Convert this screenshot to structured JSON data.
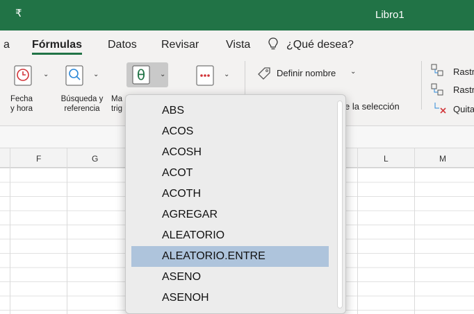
{
  "titlebar": {
    "quick_access": "₹",
    "document_title": "Libro1"
  },
  "tabs": [
    {
      "label": "a"
    },
    {
      "label": "Fórmulas",
      "active": true
    },
    {
      "label": "Datos"
    },
    {
      "label": "Revisar"
    },
    {
      "label": "Vista"
    },
    {
      "label": "¿Qué desea?"
    }
  ],
  "ribbon": {
    "fecha_label_1": "Fecha",
    "fecha_label_2": "y hora",
    "busqueda_label_1": "Búsqueda y",
    "busqueda_label_2": "referencia",
    "mat_label_1": "Ma",
    "mat_label_2": "trig",
    "definir_nombre": "Definir nombre",
    "desde_seleccion": "e la selección",
    "rastrear_1": "Rastr",
    "rastrear_2": "Rastr",
    "quitar": "Quita"
  },
  "columns": [
    "F",
    "G",
    "L",
    "M"
  ],
  "dropdown": {
    "items": [
      "ABS",
      "ACOS",
      "ACOSH",
      "ACOT",
      "ACOTH",
      "AGREGAR",
      "ALEATORIO",
      "ALEATORIO.ENTRE",
      "ASENO",
      "ASENOH"
    ],
    "selected": "ALEATORIO.ENTRE"
  },
  "colors": {
    "brand": "#217346",
    "selection": "#aec4dc"
  }
}
